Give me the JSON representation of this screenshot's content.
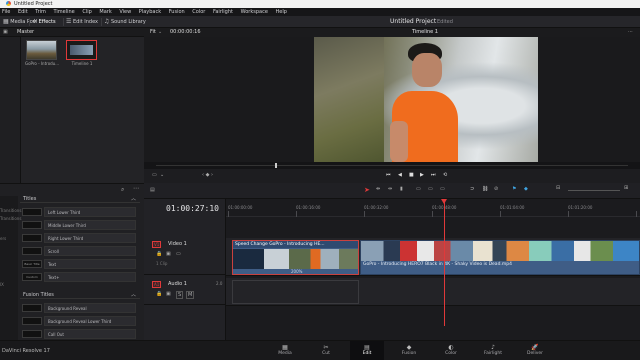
{
  "window_title": "Untitled Project",
  "menu": [
    "DaVinci Resolve",
    "File",
    "Edit",
    "Trim",
    "Timeline",
    "Clip",
    "Mark",
    "View",
    "Playback",
    "Fusion",
    "Color",
    "Fairlight",
    "Workspace",
    "Help"
  ],
  "toolbar": {
    "media_pool": "Media Pool",
    "effects": "Effects",
    "edit_index": "Edit Index",
    "sound_library": "Sound Library",
    "project_title": "Untitled Project",
    "project_status": "Edited"
  },
  "media_pool": {
    "bin": "Master",
    "clips": [
      {
        "name": "GoPro - Introdu..."
      },
      {
        "name": "Timeline 1"
      }
    ]
  },
  "viewer": {
    "fit": "Fit",
    "timecode": "00:00:00:16",
    "timeline_name": "Timeline 1"
  },
  "effects": {
    "left_labels": [
      "Transitions",
      "Transitions",
      "ers",
      "IX"
    ],
    "titles_header": "Titles",
    "titles": [
      {
        "icon_text": "",
        "label": "Left Lower Third"
      },
      {
        "icon_text": "",
        "label": "Middle Lower Third"
      },
      {
        "icon_text": "",
        "label": "Right Lower Third"
      },
      {
        "icon_text": "",
        "label": "Scroll"
      },
      {
        "icon_text": "Basic Title",
        "label": "Text"
      },
      {
        "icon_text": "Custom Title",
        "label": "Text+"
      }
    ],
    "fusion_header": "Fusion Titles",
    "fusion_titles": [
      {
        "label": "Background Reveal"
      },
      {
        "label": "Background Reveal Lower Third"
      },
      {
        "label": "Call Out"
      }
    ]
  },
  "timeline": {
    "timecode": "01:00:27:10",
    "ruler": [
      "01:00:00:00",
      "01:00:16:00",
      "01:00:32:00",
      "01:00:48:00",
      "01:01:04:00",
      "01:01:20:00"
    ],
    "video_track": {
      "id": "V1",
      "name": "Video 1",
      "clip_count": "1 Clip"
    },
    "audio_track": {
      "id": "A1",
      "name": "Audio 1",
      "level": "2.0"
    },
    "clip_speed_title": "Speed Change  GoPro - Introducing HE...",
    "clip_main_title": "GoPro - Introducing HERO7 Black in 4K - Shaky Video is Dead.mp4",
    "clip_speed_pct": "200%"
  },
  "footer": {
    "app_version": "DaVinci Resolve 17"
  },
  "pages": [
    {
      "name": "Media",
      "icon": "▦"
    },
    {
      "name": "Cut",
      "icon": "✂"
    },
    {
      "name": "Edit",
      "icon": "▤"
    },
    {
      "name": "Fusion",
      "icon": "◆"
    },
    {
      "name": "Color",
      "icon": "◐"
    },
    {
      "name": "Fairlight",
      "icon": "♪"
    },
    {
      "name": "Deliver",
      "icon": "🚀"
    }
  ],
  "colors": {
    "accent": "#e0393a",
    "clip_blue": "#3f5d86",
    "clip_selected": "#c9413f"
  }
}
